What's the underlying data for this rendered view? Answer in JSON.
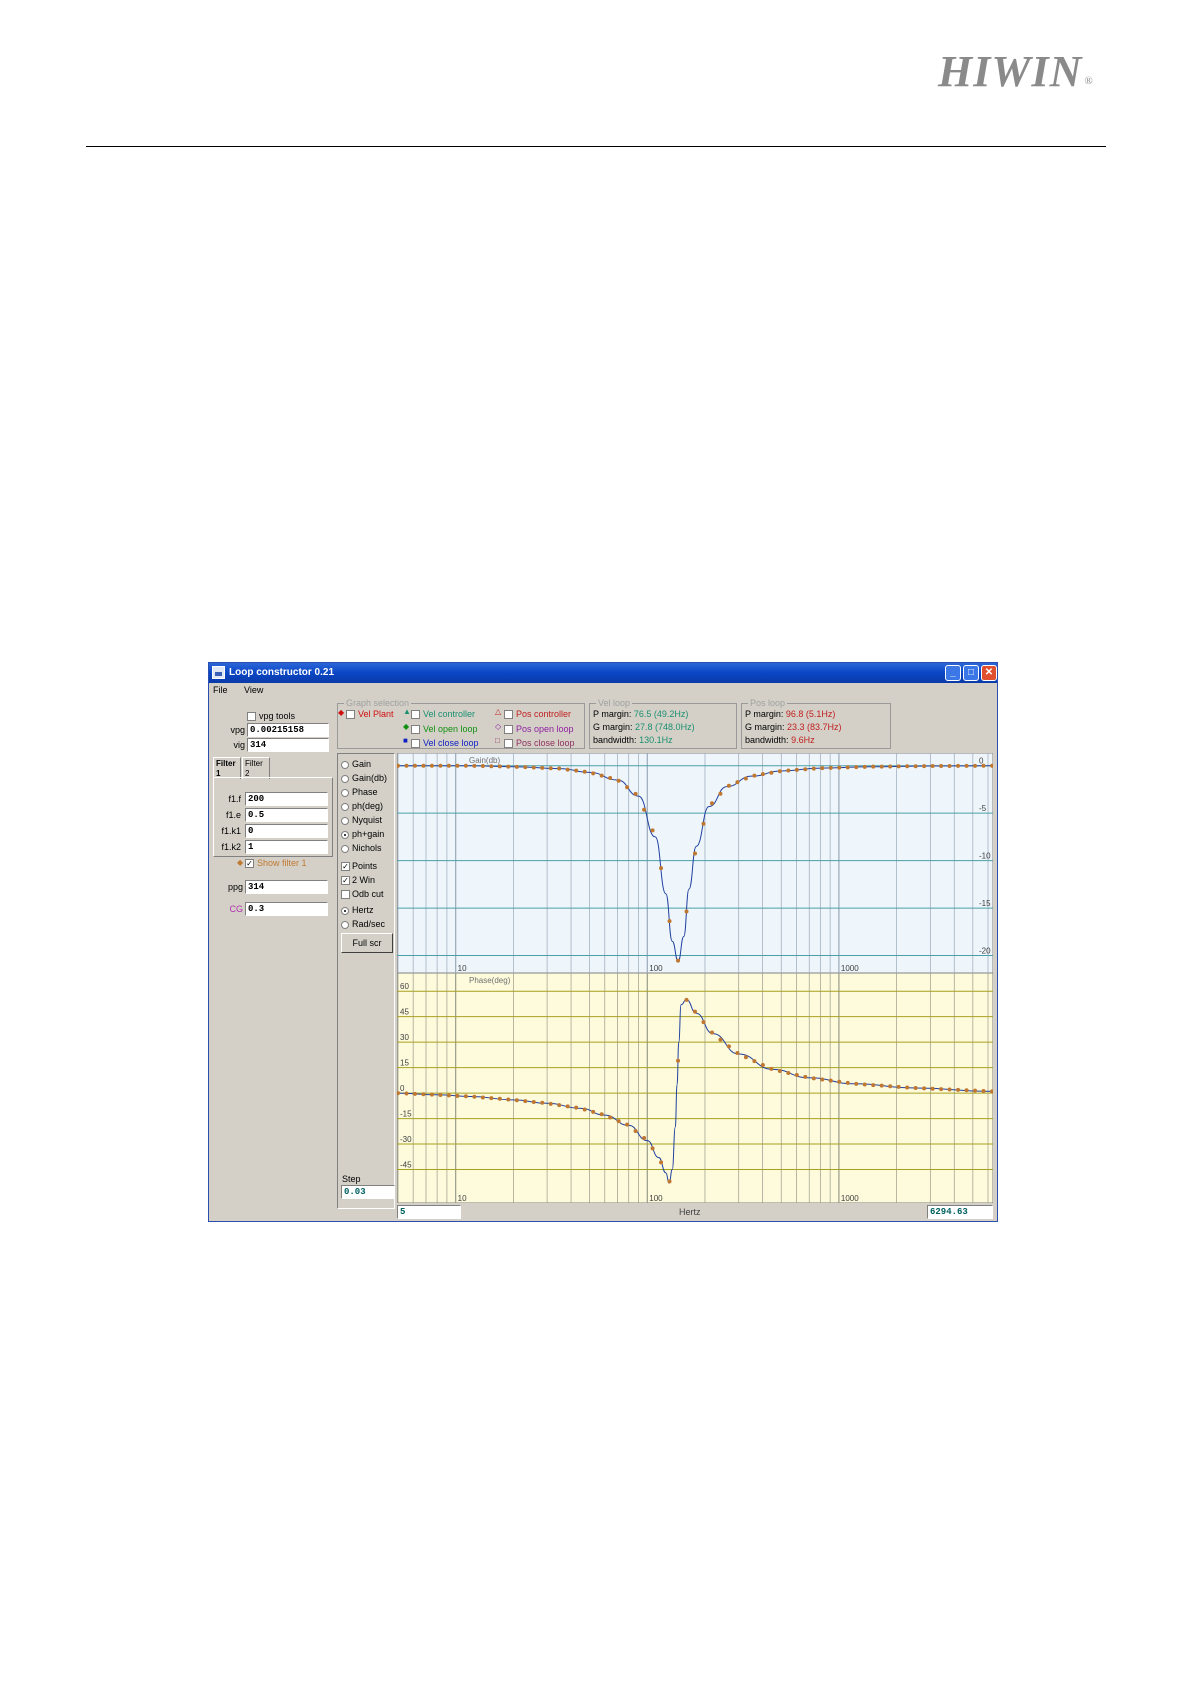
{
  "header": {
    "logo": "HIWIN",
    "registered": "®"
  },
  "window": {
    "title": "Loop constructor 0.21",
    "menu": [
      "File",
      "View"
    ]
  },
  "left_panel": {
    "vpg_tools": "vpg tools",
    "vpg_label": "vpg",
    "vpg_value": "0.00215158",
    "vig_label": "vig",
    "vig_value": "314",
    "tabs": [
      "Filter 1",
      "Filter 2"
    ],
    "filter_fields": [
      {
        "label": "f1.f",
        "value": "200"
      },
      {
        "label": "f1.e",
        "value": "0.5"
      },
      {
        "label": "f1.k1",
        "value": "0"
      },
      {
        "label": "f1.k2",
        "value": "1"
      }
    ],
    "show_filter": "Show filter 1",
    "ppg_label": "ppg",
    "ppg_value": "314",
    "cg_label": "CG",
    "cg_value": "0.3"
  },
  "graph_selection": {
    "title": "Graph selection",
    "items": [
      {
        "label": "Vel Plant",
        "color": "#d01010"
      },
      {
        "label": "Vel controller",
        "color": "#1a9070"
      },
      {
        "label": "Pos controller",
        "color": "#c02020"
      },
      {
        "label": "Vel open loop",
        "color": "#109010"
      },
      {
        "label": "Pos open loop",
        "color": "#9020a0"
      },
      {
        "label": "Vel close loop",
        "color": "#1020c0"
      },
      {
        "label": "Pos close loop",
        "color": "#903060"
      }
    ]
  },
  "vel_loop": {
    "title": "Vel loop",
    "p_label": "P margin:",
    "p_value": "76.5 (49.2Hz)",
    "g_label": "G margin:",
    "g_value": "27.8 (748.0Hz)",
    "bw_label": "bandwidth:",
    "bw_value": "130.1Hz"
  },
  "pos_loop": {
    "title": "Pos loop",
    "p_label": "P margin:",
    "p_value": "96.8 (5.1Hz)",
    "g_label": "G margin:",
    "g_value": "23.3 (83.7Hz)",
    "bw_label": "bandwidth:",
    "bw_value": "9.6Hz"
  },
  "view_options": {
    "radios": [
      {
        "label": "Gain",
        "checked": false
      },
      {
        "label": "Gain(db)",
        "checked": false
      },
      {
        "label": "Phase",
        "checked": false
      },
      {
        "label": "ph(deg)",
        "checked": false
      },
      {
        "label": "Nyquist",
        "checked": false
      },
      {
        "label": "ph+gain",
        "checked": true
      },
      {
        "label": "Nichols",
        "checked": false
      }
    ],
    "checks": [
      {
        "label": "Points",
        "checked": true
      },
      {
        "label": "2 Win",
        "checked": true
      },
      {
        "label": "Odb cut",
        "checked": false
      }
    ],
    "units": [
      {
        "label": "Hertz",
        "checked": true
      },
      {
        "label": "Rad/sec",
        "checked": false
      }
    ],
    "full_screen": "Full scr",
    "step_label": "Step",
    "step_value": "0.03"
  },
  "bottom_bar": {
    "min_freq": "5",
    "x_label": "Hertz",
    "max_freq": "6294.63"
  },
  "chart_data": [
    {
      "type": "line",
      "title": "Gain(db)",
      "xlabel": "",
      "ylabel": "",
      "x_scale": "log",
      "xlim": [
        5,
        6294.63
      ],
      "ylim": [
        -21,
        0.5
      ],
      "x_ticks": [
        "10",
        "100",
        "1000"
      ],
      "y_ticks": [
        "0",
        "-5",
        "-10",
        "-15",
        "-20"
      ],
      "grid": true,
      "series": [
        {
          "color": "#c07830",
          "x": [
            5,
            8,
            12,
            20,
            35,
            50,
            70,
            90,
            110,
            125,
            135,
            145,
            155,
            165,
            180,
            210,
            260,
            350,
            500,
            800,
            1500,
            3000,
            6294.63
          ],
          "y": [
            0,
            0,
            0,
            -0.1,
            -0.3,
            -0.7,
            -1.5,
            -3.2,
            -7.5,
            -13.5,
            -18.5,
            -20.6,
            -18.0,
            -13.0,
            -8.5,
            -4.3,
            -2.2,
            -1.1,
            -0.55,
            -0.25,
            -0.1,
            -0.03,
            0
          ]
        }
      ]
    },
    {
      "type": "line",
      "title": "Phase(deg)",
      "xlabel": "Hertz",
      "ylabel": "",
      "x_scale": "log",
      "xlim": [
        5,
        6294.63
      ],
      "ylim": [
        -60,
        66
      ],
      "x_ticks": [
        "10",
        "100",
        "1000"
      ],
      "y_ticks": [
        "60",
        "45",
        "30",
        "15",
        "0",
        "-15",
        "-30",
        "-45"
      ],
      "grid": true,
      "series": [
        {
          "color": "#c07830",
          "x": [
            5,
            8,
            12,
            20,
            30,
            45,
            60,
            80,
            100,
            115,
            125,
            130,
            135,
            140,
            143,
            146,
            150,
            160,
            180,
            220,
            300,
            450,
            700,
            1200,
            2500,
            6294.63
          ],
          "y": [
            0,
            -1,
            -2,
            -4,
            -6,
            -9,
            -13,
            -19,
            -28,
            -38,
            -47,
            -53,
            -45,
            -20,
            5,
            30,
            52,
            55,
            47,
            35,
            23,
            14,
            9,
            5.5,
            3,
            1
          ]
        }
      ]
    }
  ]
}
